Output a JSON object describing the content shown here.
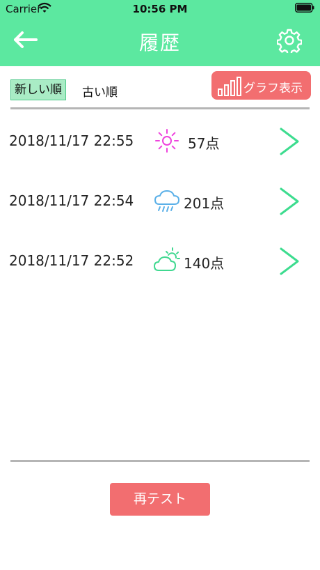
{
  "status_bar": {
    "carrier": "Carrier",
    "time": "10:56 PM"
  },
  "nav": {
    "title": "履歴",
    "back_icon": "arrow-left-icon",
    "settings_icon": "gear-icon"
  },
  "sort": {
    "newest_label": "新しい順",
    "oldest_label": "古い順",
    "selected": "newest"
  },
  "graph_button": {
    "label": "グラフ表示",
    "icon": "bar-chart-icon"
  },
  "history": [
    {
      "date": "2018/11/17 22:55",
      "weather": "sunny",
      "score": "57点"
    },
    {
      "date": "2018/11/17 22:54",
      "weather": "rainy",
      "score": "201点"
    },
    {
      "date": "2018/11/17 22:52",
      "weather": "partly-cloudy",
      "score": "140点"
    }
  ],
  "retest_button": {
    "label": "再テスト"
  },
  "colors": {
    "header": "#5ce8a0",
    "accent": "#f26e70",
    "chevron": "#3ddc8f",
    "sunny": "#ee44dd",
    "rain": "#5ab0e8",
    "cloudy": "#40d890"
  }
}
